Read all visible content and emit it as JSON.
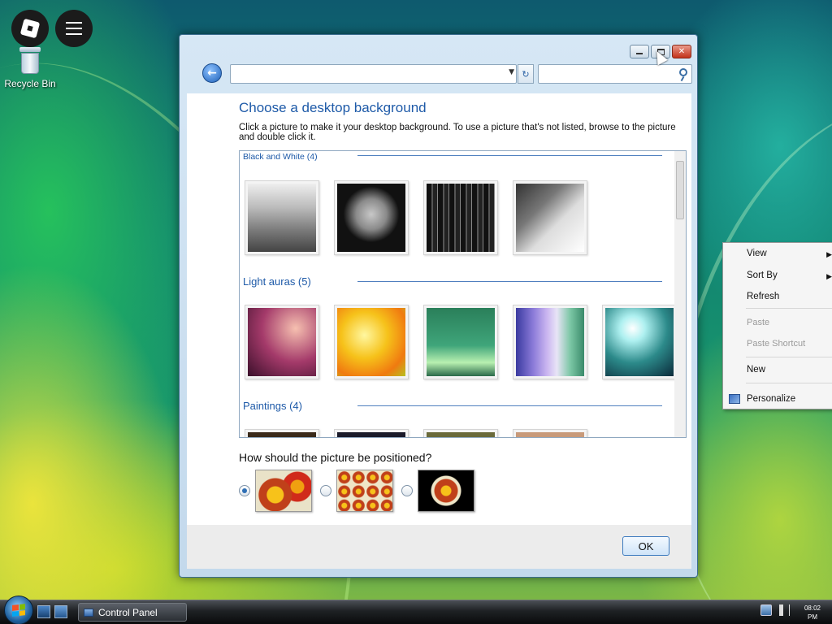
{
  "desktop": {
    "recycle_bin_label": "Recycle Bin"
  },
  "window": {
    "address_value": "",
    "search_placeholder": "",
    "title": "Choose a desktop background",
    "description": "Click a picture to make it your desktop background. To use a picture that's not listed, browse to the picture and double click it.",
    "groups": [
      {
        "label": "Black and White (4)",
        "toggle": "^",
        "thumbs": [
          "bw-train",
          "bw-flower",
          "bw-city",
          "bw-cliff"
        ]
      },
      {
        "label": "Light auras (5)",
        "toggle": "^",
        "thumbs": [
          "aura-magenta",
          "aura-orange",
          "aura-green",
          "aura-stripes",
          "aura-teal"
        ]
      },
      {
        "label": "Paintings (4)",
        "toggle": "^",
        "thumbs": [
          "paint-1",
          "paint-2",
          "paint-3",
          "paint-4"
        ]
      }
    ],
    "position_question": "How should the picture be positioned?",
    "position_options": [
      {
        "name": "fit-to-screen",
        "selected": true
      },
      {
        "name": "tile",
        "selected": false
      },
      {
        "name": "center",
        "selected": false
      }
    ],
    "ok_label": "OK"
  },
  "context_menu": {
    "items": [
      {
        "label": "View",
        "submenu": true,
        "disabled": false
      },
      {
        "label": "Sort By",
        "submenu": true,
        "disabled": false
      },
      {
        "label": "Refresh",
        "submenu": false,
        "disabled": false
      },
      {
        "label": "Paste",
        "submenu": false,
        "disabled": true
      },
      {
        "label": "Paste Shortcut",
        "submenu": false,
        "disabled": true
      },
      {
        "label": "New",
        "submenu": false,
        "disabled": false
      },
      {
        "label": "Personalize",
        "submenu": false,
        "disabled": false
      }
    ]
  },
  "taskbar": {
    "task_label": "Control Panel",
    "clock_time": "08:02",
    "clock_ampm": "PM"
  },
  "colors": {
    "accent_blue": "#1e5aa8",
    "taskbar_dark": "#1e2124"
  }
}
